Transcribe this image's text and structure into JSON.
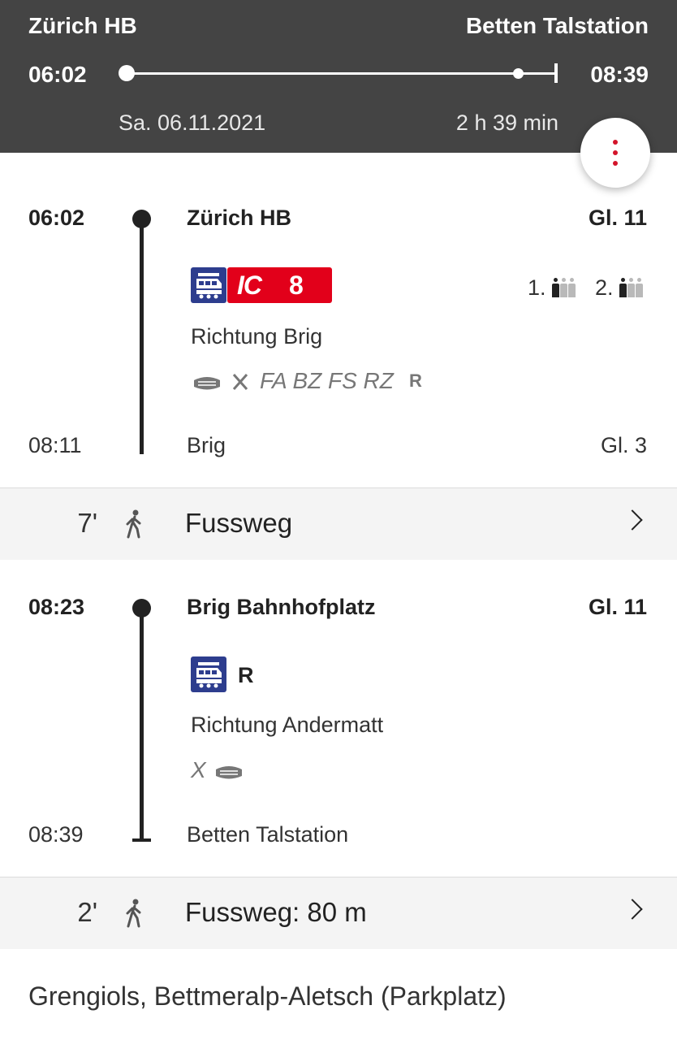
{
  "header": {
    "from": "Zürich HB",
    "to": "Betten Talstation",
    "departure": "06:02",
    "arrival": "08:39",
    "date": "Sa. 06.11.2021",
    "duration": "2 h 39 min",
    "accent_color": "#d3142a",
    "background_color": "#444444"
  },
  "menu_button": {
    "icon": "more-vertical-icon"
  },
  "legs": [
    {
      "dep_time": "06:02",
      "dep_stop": "Zürich HB",
      "dep_track": "Gl. 11",
      "transport_icon": "train-icon",
      "line_product": "IC",
      "line_number": "8",
      "line_color": "#e2001a",
      "occupancy_first": "1.",
      "occupancy_second": "2.",
      "direction": "Richtung Brig",
      "attributes": "FA BZ FS RZ",
      "attribute_suffix": "R",
      "arr_time": "08:11",
      "arr_stop": "Brig",
      "arr_track": "Gl. 3"
    },
    {
      "dep_time": "08:23",
      "dep_stop": "Brig Bahnhofplatz",
      "dep_track": "Gl. 11",
      "transport_icon": "train-icon",
      "line_label": "R",
      "direction": "Richtung Andermatt",
      "attributes": "X",
      "arr_time": "08:39",
      "arr_stop": "Betten Talstation"
    }
  ],
  "walks": [
    {
      "minutes": "7'",
      "label": "Fussweg"
    },
    {
      "minutes": "2'",
      "label": "Fussweg: 80 m"
    }
  ],
  "final_destination": "Grengiols, Bettmeralp-Aletsch (Parkplatz)"
}
